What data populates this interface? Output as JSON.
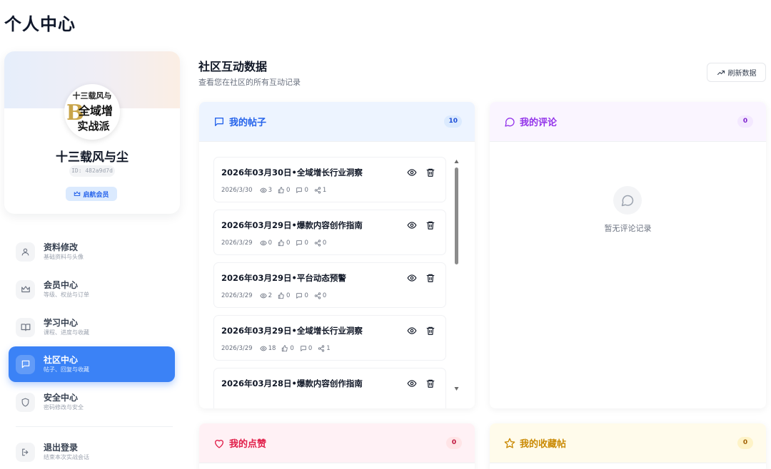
{
  "page": {
    "title": "个人中心"
  },
  "profile": {
    "avatar_text_lines": [
      "十三载风与",
      "全域增",
      "实战派"
    ],
    "name": "十三载风与尘",
    "id": "ID: 482a9d7d",
    "badge": "启航会员"
  },
  "sidebar": {
    "items": [
      {
        "title": "资料修改",
        "subtitle": "基础资料与头像",
        "icon": "user-icon",
        "active": false
      },
      {
        "title": "会员中心",
        "subtitle": "等级、权益与订单",
        "icon": "crown-icon",
        "active": false
      },
      {
        "title": "学习中心",
        "subtitle": "课程、进度与收藏",
        "icon": "book-icon",
        "active": false
      },
      {
        "title": "社区中心",
        "subtitle": "帖子、回复与收藏",
        "icon": "message-square-icon",
        "active": true
      },
      {
        "title": "安全中心",
        "subtitle": "密码修改与安全",
        "icon": "shield-icon",
        "active": false
      }
    ],
    "logout": {
      "title": "退出登录",
      "subtitle": "结束本次实战会话",
      "icon": "logout-icon"
    }
  },
  "main": {
    "title": "社区互动数据",
    "subtitle": "查看您在社区的所有互动记录",
    "refresh_label": "刷新数据"
  },
  "panels": {
    "posts": {
      "title": "我的帖子",
      "count": "10"
    },
    "comments": {
      "title": "我的评论",
      "count": "0",
      "empty_text": "暂无评论记录"
    },
    "likes": {
      "title": "我的点赞",
      "count": "0"
    },
    "favorites": {
      "title": "我的收藏帖",
      "count": "0"
    }
  },
  "posts": [
    {
      "title": "2026年03月30日•全域增长行业洞察",
      "date": "2026/3/30",
      "views": "3",
      "likes": "0",
      "comments": "0",
      "shares": "1"
    },
    {
      "title": "2026年03月29日•爆款内容创作指南",
      "date": "2026/3/29",
      "views": "0",
      "likes": "0",
      "comments": "0",
      "shares": "0"
    },
    {
      "title": "2026年03月29日•平台动态预警",
      "date": "2026/3/29",
      "views": "2",
      "likes": "0",
      "comments": "0",
      "shares": "0"
    },
    {
      "title": "2026年03月29日•全域增长行业洞察",
      "date": "2026/3/29",
      "views": "18",
      "likes": "0",
      "comments": "0",
      "shares": "1"
    },
    {
      "title": "2026年03月28日•爆款内容创作指南",
      "date": "",
      "views": "",
      "likes": "",
      "comments": "",
      "shares": ""
    }
  ],
  "colors": {
    "accent": "#3b82f6",
    "posts": "#2563eb",
    "comments": "#9333ea",
    "likes": "#e11d48",
    "favorites": "#ca8a04"
  }
}
